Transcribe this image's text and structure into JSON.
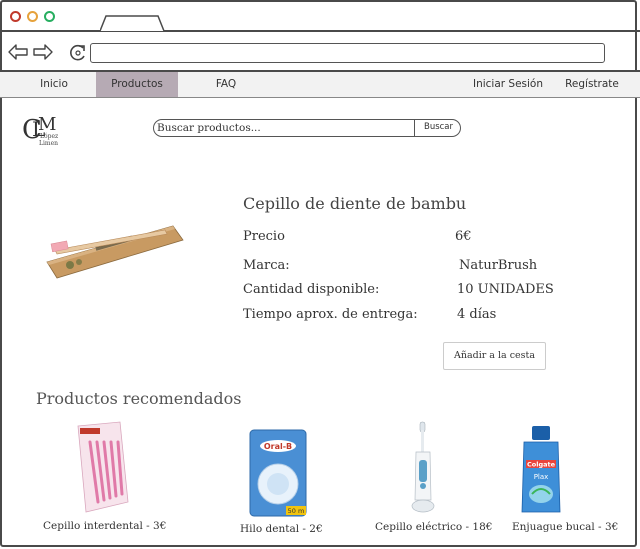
{
  "nav": {
    "items": [
      {
        "label": "Inicio"
      },
      {
        "label": "Productos"
      },
      {
        "label": "FAQ"
      }
    ],
    "right": [
      {
        "label": "Iniciar Sesión"
      },
      {
        "label": "Regístrate"
      }
    ],
    "active_color": "#b6aab4"
  },
  "logo": {
    "letters": "CLM",
    "small_text_1": "López",
    "small_text_2": "Limen"
  },
  "search": {
    "placeholder": "Buscar productos...",
    "button_label": "Buscar"
  },
  "product": {
    "title": "Cepillo de diente de bambu",
    "rows": [
      {
        "label": "Precio",
        "value": "6€"
      },
      {
        "label": "Marca:",
        "value": "NaturBrush"
      },
      {
        "label": "Cantidad disponible:",
        "value": "10 UNIDADES"
      },
      {
        "label": "Tiempo aprox. de entrega:",
        "value": "4 días"
      }
    ],
    "add_button": "Añadir a la cesta"
  },
  "recommended": {
    "title": "Productos recomendados",
    "items": [
      {
        "caption": "Cepillo interdental - 3€"
      },
      {
        "caption": "Hilo dental - 2€"
      },
      {
        "caption": "Cepillo eléctrico - 18€"
      },
      {
        "caption": "Enjuague bucal - 3€"
      }
    ]
  },
  "floss_label": "Oral-B",
  "floss_meters": "50 m",
  "mouthwash_label": "Colgate",
  "mouthwash_sub": "Plax"
}
